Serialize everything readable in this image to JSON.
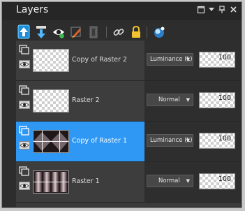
{
  "panel": {
    "title": "Layers",
    "window_buttons": [
      "maximize-icon",
      "dropdown-arrow-icon",
      "pin-icon",
      "close-icon"
    ]
  },
  "toolbar": {
    "icons": [
      "new-raster-layer-icon",
      "new-layer-down-icon",
      "eye-visibility-icon",
      "edit-brush-icon",
      "mask-icon",
      "link-icon",
      "lock-icon",
      "blend-sphere-icon"
    ]
  },
  "layers": [
    {
      "name": "Copy of Raster 2",
      "blend_mode": "Luminance (L)",
      "opacity": "100",
      "selected": false,
      "thumbnail": "checker-gray"
    },
    {
      "name": "Raster 2",
      "blend_mode": "Normal",
      "opacity": "100",
      "selected": false,
      "thumbnail": "checker-gray"
    },
    {
      "name": "Copy of Raster 1",
      "blend_mode": "Luminance (L)",
      "opacity": "100",
      "selected": true,
      "thumbnail": "dark-pattern"
    },
    {
      "name": "Raster 1",
      "blend_mode": "Normal",
      "opacity": "100",
      "selected": false,
      "thumbnail": "dark-pattern"
    }
  ],
  "colors": {
    "selection": "#2f98f4",
    "panel_bg": "#2d2d2d"
  }
}
